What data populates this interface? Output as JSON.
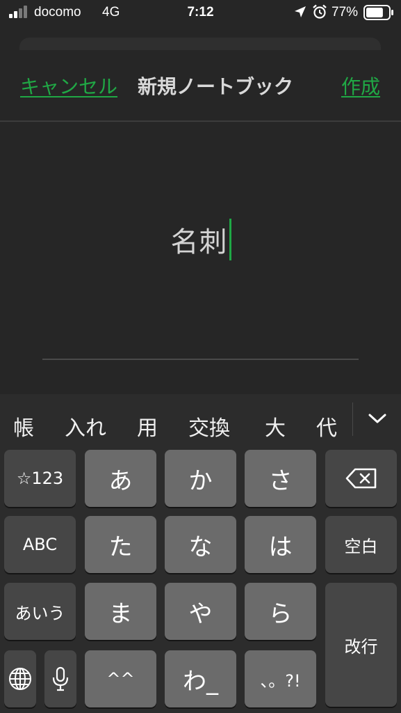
{
  "status_bar": {
    "carrier": "docomo",
    "network": "4G",
    "time": "7:12",
    "battery_pct": "77%",
    "battery_level": 0.77
  },
  "header": {
    "cancel_label": "キャンセル",
    "title": "新規ノートブック",
    "create_label": "作成"
  },
  "name_input": {
    "value": "名刺"
  },
  "candidates": [
    "帳",
    "入れ",
    "用",
    "交換",
    "大",
    "代"
  ],
  "keyboard": {
    "row1": [
      "☆123",
      "あ",
      "か",
      "さ"
    ],
    "row2": [
      "ABC",
      "た",
      "な",
      "は",
      "空白"
    ],
    "row3": [
      "あいう",
      "ま",
      "や",
      "ら",
      "改行"
    ],
    "row4": [
      "^^",
      "わ_",
      "、。?!"
    ]
  },
  "colors": {
    "accent": "#20a845",
    "background": "#262626",
    "key": "#6b6b6b",
    "func_key": "#464646"
  },
  "icons": [
    "signal-icon",
    "location-arrow-icon",
    "alarm-clock-icon",
    "battery-icon",
    "chevron-down-icon",
    "backspace-icon",
    "globe-icon",
    "microphone-icon"
  ]
}
